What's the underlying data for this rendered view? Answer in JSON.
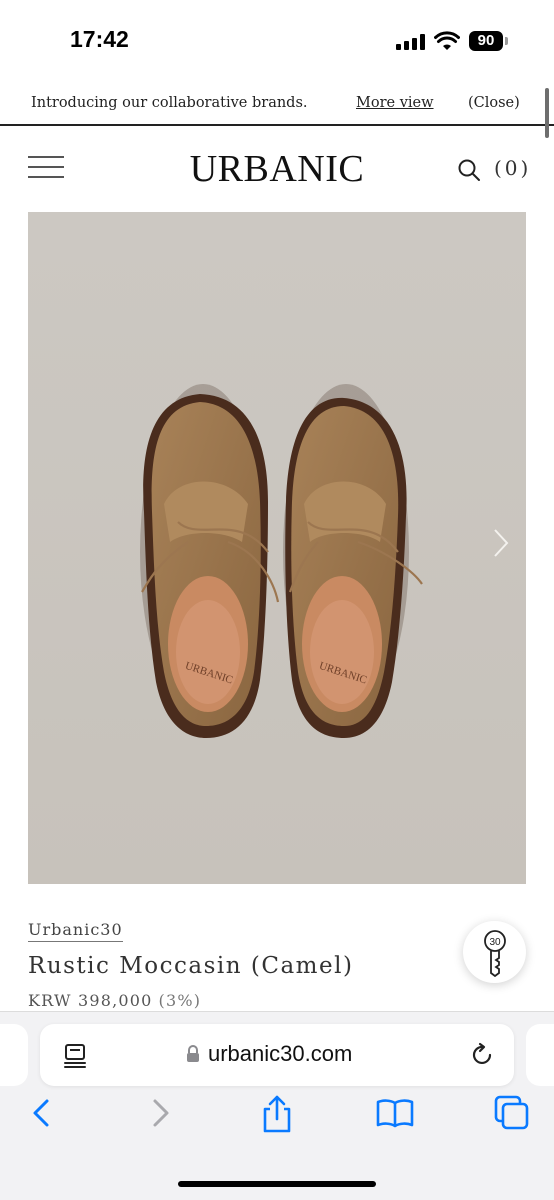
{
  "status_bar": {
    "time": "17:42",
    "battery": "90",
    "icons": [
      "cellular-signal-icon",
      "wifi-icon",
      "battery-icon"
    ]
  },
  "announcement": {
    "text": "Introducing our collaborative brands.",
    "more_link": "More view",
    "close_label": "(Close)"
  },
  "header": {
    "logo": "URBANIC",
    "cart_count": "(0)",
    "icons": [
      "menu-icon",
      "search-icon"
    ]
  },
  "product": {
    "image_description_icon": "product-photo",
    "brand": "Urbanic30",
    "name": "Rustic Moccasin (Camel)",
    "price": "KRW 398,000",
    "discount": "(3%)",
    "insole_text": "URBANIC"
  },
  "floating_button": {
    "icon": "key-icon",
    "key_label": "30"
  },
  "safari": {
    "url": "urbanic30.com",
    "icons": [
      "reader-icon",
      "lock-icon",
      "reload-icon"
    ],
    "toolbar": [
      "back-icon",
      "forward-icon",
      "share-icon",
      "bookmarks-icon",
      "tabs-icon"
    ]
  },
  "colors": {
    "photo_background": "#cbc7c1",
    "suede": "#9a7448",
    "insole": "#c98a62",
    "safari_blue": "#0a7aff"
  }
}
